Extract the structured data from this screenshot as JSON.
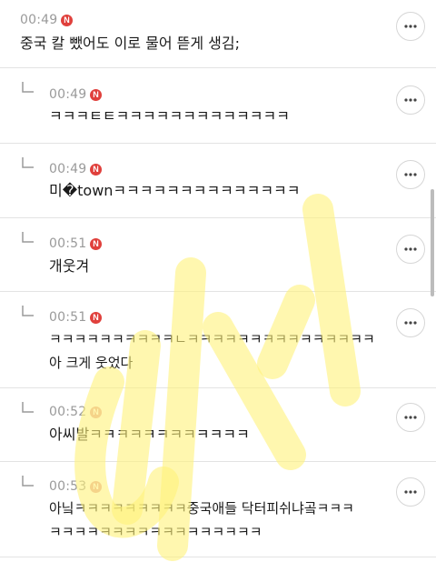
{
  "comments": [
    {
      "time": "00:49",
      "badge": "N",
      "is_reply": false,
      "lines": [
        "중국 칼 뺐어도 이로 물어 뜯게 생김;"
      ]
    },
    {
      "time": "00:49",
      "badge": "N",
      "is_reply": true,
      "lines": [
        "ㅋㅋㅋㅌㅌㅋㅋㅋㅋㅋㅋㅋㅋㅋㅋㅋㅋㅋ"
      ]
    },
    {
      "time": "00:49",
      "badge": "N",
      "is_reply": true,
      "lines": [
        "미�townㅋㅋㅋㅋㅋㅋㅋㅋㅋㅋㅋㅋㅋㅋ"
      ]
    },
    {
      "time": "00:51",
      "badge": "N",
      "is_reply": true,
      "lines": [
        "개웃겨"
      ]
    },
    {
      "time": "00:51",
      "badge": "N",
      "is_reply": true,
      "lines": [
        "ㅋㅋㅋㅋㅋㅋㅋㅋㅋㅋㄴㅋㅋㅋㅋㅋㅋㅋㅋㅋㅋㅋㅋㅋㅋㅋ",
        "아 크게 웃었다"
      ]
    },
    {
      "time": "00:52",
      "badge": "N",
      "is_reply": true,
      "lines": [
        "아씨발ㅋㅋㅋㅋㅋㅋㅋㅋㅋㅋㅋㅋ"
      ]
    },
    {
      "time": "00:53",
      "badge": "N",
      "is_reply": true,
      "lines": [
        "아닠ㅋㅋㅋㅋㅋㅋㅋㅋㅋ중국애들 닥터피쉬냐곸ㅋㅋㅋ",
        "ㅋㅋㅋㅋㅋㅋㅋㅋㅋㅋㅋㅋㅋㅋㅋㅋㅋ"
      ]
    }
  ],
  "icons": {
    "more": "more-horizontal-icon",
    "reply": "reply-arrow-icon"
  },
  "colors": {
    "badge": "#e0403c",
    "time": "#9a9a9a",
    "watermark": "#fff27a"
  }
}
